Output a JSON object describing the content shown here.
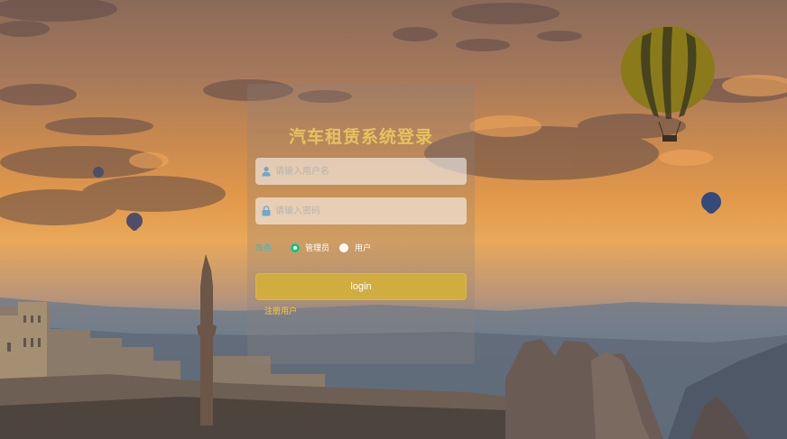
{
  "login": {
    "title": "汽车租赁系统登录",
    "username_placeholder": "请输入用户名",
    "password_placeholder": "请输入密码",
    "role_label": "角色",
    "roles": [
      "管理员",
      "用户"
    ],
    "selected_role": "管理员",
    "login_button": "login",
    "register_link": "注册用户"
  },
  "colors": {
    "title": "#e8c15e",
    "button": "#d1ad40",
    "role_label": "#3fb6c2",
    "radio_selected": "#13c38a"
  },
  "icons": {
    "username": "user-icon",
    "password": "lock-icon"
  }
}
